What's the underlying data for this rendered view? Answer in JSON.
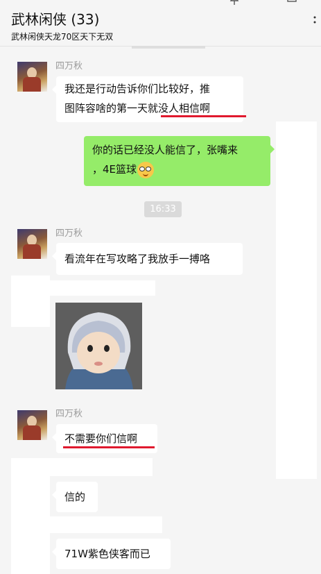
{
  "window": {
    "title": "武林闲侠 (33)",
    "subtitle": "武林闲侠天龙70区天下无双",
    "pin_icon": "pin-icon",
    "minimize_icon": "minimize-icon",
    "maximize_icon": "maximize-icon",
    "more_icon": "more-icon"
  },
  "chat": {
    "messages": [
      {
        "sender": "四万秋",
        "line1": "我还是行动告诉你们比较好，推",
        "line2": "图阵容啥的第一天就没人相信啊"
      },
      {
        "line1": "你的话已经没人能信了，张嘴来",
        "line2": "，4E篮球",
        "emoji": "nerd-face-emoji"
      },
      {
        "time": "16:33"
      },
      {
        "sender": "四万秋",
        "text": "看流年在写攻略了我放手一搏咯"
      },
      {
        "sticker": "baby-sticker-image"
      },
      {
        "sender": "四万秋",
        "text": "不需要你们信啊"
      },
      {
        "text": "信的"
      },
      {
        "text": "71W紫色侠客而已"
      }
    ]
  },
  "colors": {
    "self_bubble": "#95ec69",
    "underline": "#e0192e",
    "background": "#f5f5f5"
  }
}
